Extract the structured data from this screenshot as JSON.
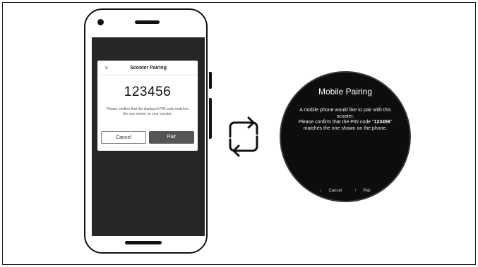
{
  "phone_dialog": {
    "close_symbol": "×",
    "title": "Scooter Pairing",
    "pin": "123456",
    "message_line1": "Please confirm that the displayed PIN code matches",
    "message_line2": "the one shown on your scooter.",
    "cancel_label": "Cancel",
    "pair_label": "Pair"
  },
  "watch_dialog": {
    "title": "Mobile Pairing",
    "line1": "A mobile phone would like to pair with this",
    "line2": "scooter.",
    "line3_prefix": "Please confirm that the PIN code \"",
    "line3_pin": "123456",
    "line3_suffix": "\"",
    "line4": "matches the one shown on the phone.",
    "cancel_arrow": "↓",
    "cancel_label": "Cancel",
    "pair_arrow": "↑",
    "pair_label": "Pair"
  },
  "icons": {
    "sync": "sync-arrows-icon",
    "close": "close-icon"
  }
}
